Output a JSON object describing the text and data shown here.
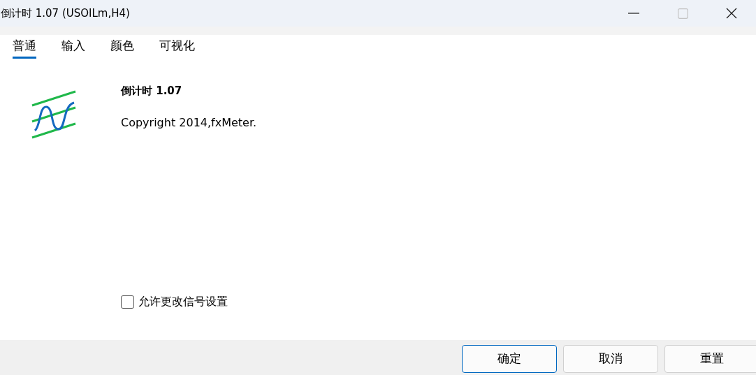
{
  "window": {
    "title": "倒计时 1.07 (USOILm,H4)",
    "controls": [
      {
        "kind": "minimize",
        "disabled": false
      },
      {
        "kind": "maximize",
        "disabled": true
      },
      {
        "kind": "close",
        "disabled": false
      }
    ]
  },
  "tabs": [
    {
      "label": "普通",
      "selected": true
    },
    {
      "label": "输入",
      "selected": false
    },
    {
      "label": "颜色",
      "selected": false
    },
    {
      "label": "可视化",
      "selected": false
    }
  ],
  "info": {
    "name": "倒计时 1.07",
    "copyright": "Copyright 2014,fxMeter."
  },
  "checkbox": {
    "label": "允许更改信号设置",
    "checked": false
  },
  "buttons": [
    {
      "label": "确定",
      "default": true
    },
    {
      "label": "取消",
      "default": false
    },
    {
      "label": "重置",
      "default": false
    }
  ]
}
